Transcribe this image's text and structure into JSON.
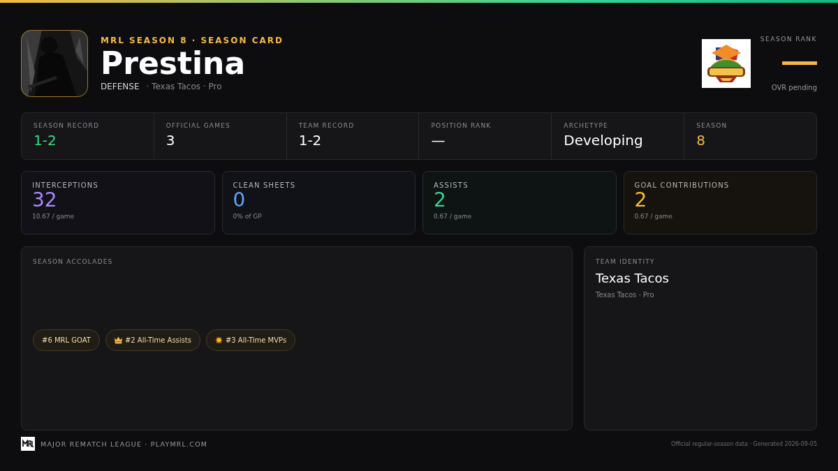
{
  "header": {
    "eyebrow": "MRL SEASON 8 · SEASON CARD",
    "name": "Prestina",
    "position": "DEFENSE",
    "meta": "· Texas Tacos · Pro"
  },
  "season_rank": {
    "label": "SEASON RANK",
    "value_bar": true,
    "note": "OVR pending"
  },
  "record": [
    {
      "label": "SEASON RECORD",
      "value": "1-2",
      "color": "#3ddc84"
    },
    {
      "label": "OFFICIAL GAMES",
      "value": "3",
      "color": "#ffffff"
    },
    {
      "label": "TEAM RECORD",
      "value": "1-2",
      "color": "#ffffff"
    },
    {
      "label": "POSITION RANK",
      "value": "—",
      "color": "#ffffff"
    },
    {
      "label": "ARCHETYPE",
      "value": "Developing",
      "color": "#ffffff"
    },
    {
      "label": "SEASON",
      "value": "8",
      "color": "#f5b942"
    }
  ],
  "stats": [
    {
      "label": "INTERCEPTIONS",
      "value": "32",
      "sub": "10.67 / game",
      "color": "#a78bfa"
    },
    {
      "label": "CLEAN SHEETS",
      "value": "0",
      "sub": "0% of GP",
      "color": "#60a5fa"
    },
    {
      "label": "ASSISTS",
      "value": "2",
      "sub": "0.67 / game",
      "color": "#34d399"
    },
    {
      "label": "GOAL CONTRIBUTIONS",
      "value": "2",
      "sub": "0.67 / game",
      "color": "#fbbf24"
    }
  ],
  "accolades": {
    "title": "SEASON ACCOLADES",
    "items": [
      {
        "label": "#6 MRL GOAT",
        "kind": "plain"
      },
      {
        "label": "#2 All-Time Assists",
        "kind": "crown"
      },
      {
        "label": "#3 All-Time MVPs",
        "kind": "sun"
      }
    ]
  },
  "team_identity": {
    "title": "TEAM IDENTITY",
    "team": "Texas Tacos",
    "sub": "Texas Tacos · Pro"
  },
  "footer": {
    "league": "MAJOR REMATCH LEAGUE · PLAYMRL.COM",
    "note": "Official regular-season data · Generated 2026-09-05"
  }
}
